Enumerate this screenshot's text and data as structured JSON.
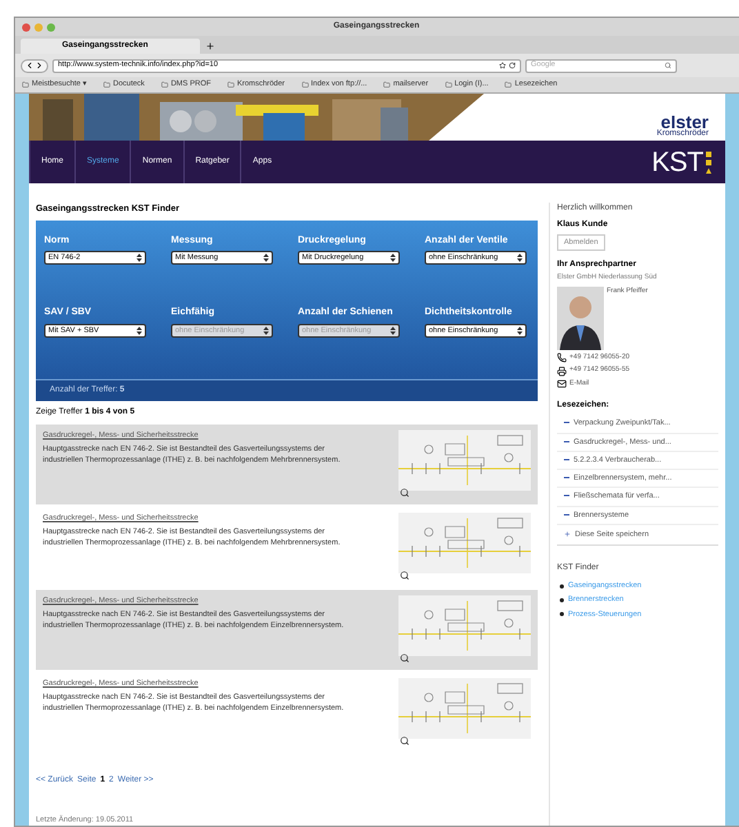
{
  "window": {
    "title": "Gaseingangsstrecken"
  },
  "tabs": [
    {
      "label": "Gaseingangsstrecken",
      "selected": true
    }
  ],
  "address_bar": {
    "url": "http://www.system-technik.info/index.php?id=10"
  },
  "search": {
    "placeholder": "Google"
  },
  "bookmarks": [
    "Meistbesuchte ▾",
    "Docuteck",
    "DMS PROF",
    "Kromschröder",
    "Index von ftp://...",
    "mailserver",
    "Login (I)...",
    "Lesezeichen"
  ],
  "banner": {
    "logo": "elster",
    "brand": "Kromschröder"
  },
  "nav": {
    "items": [
      {
        "label": "Home",
        "selected": false
      },
      {
        "label": "Systeme",
        "selected": true
      },
      {
        "label": "Normen",
        "selected": false
      },
      {
        "label": "Ratgeber",
        "selected": false
      },
      {
        "label": "Apps",
        "selected": false
      }
    ],
    "logo": "KST"
  },
  "finder": {
    "title": "Gaseingangsstrecken KST Finder",
    "filters": [
      {
        "label": "Norm",
        "value": "EN 746-2",
        "disabled": false
      },
      {
        "label": "Messung",
        "value": "Mit Messung",
        "disabled": false
      },
      {
        "label": "Druckregelung",
        "value": "Mit Druckregelung",
        "disabled": false
      },
      {
        "label": "Anzahl der Ventile",
        "value": "ohne Einschränkung",
        "disabled": false
      },
      {
        "label": "SAV / SBV",
        "value": "Mit SAV + SBV",
        "disabled": false
      },
      {
        "label": "Eichfähig",
        "value": "ohne Einschränkung",
        "disabled": true
      },
      {
        "label": "Anzahl der Schienen",
        "value": "ohne Einschränkung",
        "disabled": true
      },
      {
        "label": "Dichtheitskontrolle",
        "value": "ohne Einschränkung",
        "disabled": false
      }
    ],
    "hits": "Anzahl der Treffer: **5**"
  },
  "showing": "Zeige Treffer **1 bis 4 von 5**",
  "results": [
    {
      "title": "Gasdruckregel-, Mess- und Sicherheitsstrecke",
      "text": "Hauptgasstrecke nach EN 746-2. Sie ist Bestandteil des Gasverteilungssystems der industriellen Thermoprozessanlage (ITHE) z. B. bei nachfolgendem Mehrbrennersystem."
    },
    {
      "title": "Gasdruckregel-, Mess- und Sicherheitsstrecke",
      "text": "Hauptgasstrecke nach EN 746-2. Sie ist Bestandteil des Gasverteilungssystems der industriellen Thermoprozessanlage (ITHE) z. B. bei nachfolgendem Mehrbrennersystem."
    },
    {
      "title": "Gasdruckregel-, Mess- und Sicherheitsstrecke",
      "text": "Hauptgasstrecke nach EN 746-2. Sie ist Bestandteil des Gasverteilungssystems der industriellen Thermoprozessanlage (ITHE) z. B. bei nachfolgendem Einzelbrennersystem."
    },
    {
      "title": "Gasdruckregel-, Mess- und Sicherheitsstrecke",
      "text": "Hauptgasstrecke nach EN 746-2. Sie ist Bestandteil des Gasverteilungssystems der industriellen Thermoprozessanlage (ITHE) z. B. bei nachfolgendem Einzelbrennersystem."
    }
  ],
  "pagination": {
    "prev": "<< Zurück",
    "page_label": "Seite",
    "pages": [
      {
        "label": "1",
        "selected": true
      },
      {
        "label": "2",
        "selected": false
      }
    ],
    "next": "Weiter >>"
  },
  "last_modified": "Letzte Änderung: 19.05.2011",
  "sidebar": {
    "welcome": "Herzlich willkommen",
    "user": "Klaus Kunde",
    "logout": "Abmelden",
    "contact_heading": "Ihr Ansprechpartner",
    "company": "Elster GmbH Niederlassung Süd",
    "contact_name": "Frank Pfeiffer",
    "contacts": [
      {
        "kind": "phone",
        "text": "+49 7142 96055-20"
      },
      {
        "kind": "fax",
        "text": "+49 7142 96055-55"
      },
      {
        "kind": "mail",
        "text": "E-Mail"
      }
    ],
    "bookmarks_heading": "Lesezeichen:",
    "bookmarks": [
      "Verpackung Zweipunkt/Tak...",
      "Gasdruckregel-, Mess- und...",
      "5.2.2.3.4 Verbraucherab...",
      "Einzelbrennersystem, mehr...",
      "Fließschemata für verfa...",
      "Brennersysteme"
    ],
    "save": "Diese Seite speichern",
    "finder_heading": "KST Finder",
    "finder_links": [
      "Gaseingangsstrecken",
      "Brennerstrecken",
      "Prozess-Steuerungen"
    ]
  }
}
